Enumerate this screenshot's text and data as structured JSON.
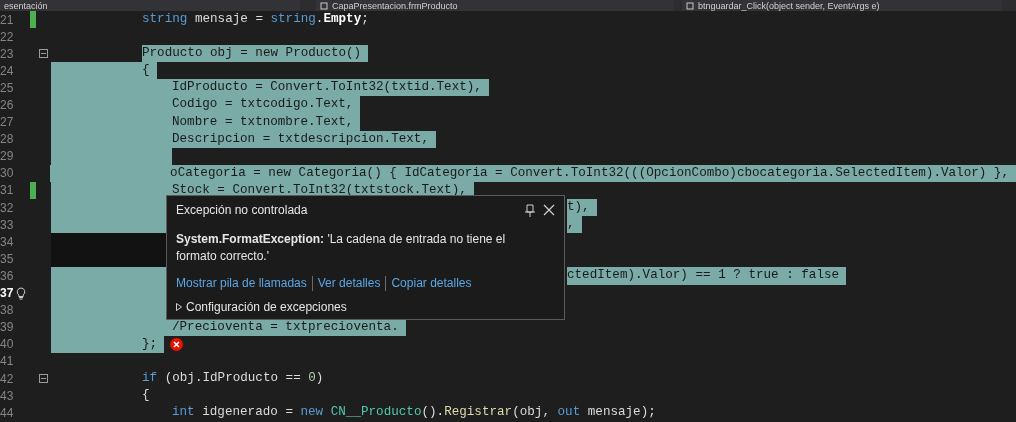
{
  "nav_bar": {
    "items": [
      {
        "label": "esentación",
        "icon": false
      },
      {
        "label": "CapaPresentacion.frmProducto",
        "icon": true
      },
      {
        "label": "btnguardar_Click(object sender, EventArgs e)",
        "icon": true
      }
    ]
  },
  "editor": {
    "lines": [
      {
        "number": "21",
        "kind": "code",
        "changed": true,
        "current": false,
        "fold": false,
        "selected": false,
        "tokens": [
          {
            "t": "string",
            "kind": "keyword",
            "selected": false
          },
          {
            "t": " mensaje = ",
            "kind": "plain",
            "selected": false
          },
          {
            "t": "string",
            "kind": "keyword",
            "selected": false
          },
          {
            "t": ".",
            "kind": "plain",
            "selected": false
          },
          {
            "t": "Empty",
            "kind": "bold",
            "selected": false
          },
          {
            "t": ";",
            "kind": "plain",
            "selected": false
          }
        ]
      },
      {
        "number": "22",
        "kind": "code",
        "changed": false,
        "current": false,
        "fold": false,
        "selected": false
      },
      {
        "number": "23",
        "kind": "code",
        "changed": false,
        "current": false,
        "fold": true,
        "selected": false,
        "tokens": [
          {
            "t": "Producto obj = new Producto()",
            "kind": "plain",
            "selected": true
          }
        ]
      },
      {
        "number": "24",
        "kind": "code",
        "changed": false,
        "current": false,
        "fold": false,
        "selected": true,
        "tokens": [
          {
            "t": "{",
            "kind": "plain",
            "selected": true
          }
        ],
        "children": [
          {
            "number": "25",
            "kind": "code",
            "changed": false,
            "current": false,
            "fold": false,
            "selected": true,
            "tokens": [
              {
                "t": "IdProducto = Convert.ToInt32(txtid.Text),",
                "kind": "plain",
                "selected": true
              }
            ]
          },
          {
            "number": "26",
            "kind": "code",
            "changed": false,
            "current": false,
            "fold": false,
            "selected": true,
            "tokens": [
              {
                "t": "Codigo = txtcodigo.Text,",
                "kind": "plain",
                "selected": true
              }
            ]
          },
          {
            "number": "27",
            "kind": "code",
            "changed": false,
            "current": false,
            "fold": false,
            "selected": true,
            "tokens": [
              {
                "t": "Nombre = txtnombre.Text,",
                "kind": "plain",
                "selected": true
              }
            ]
          },
          {
            "number": "28",
            "kind": "code",
            "changed": false,
            "current": false,
            "fold": false,
            "selected": true,
            "tokens": [
              {
                "t": "Descripcion = txtdescripcion.Text,",
                "kind": "plain",
                "selected": true
              }
            ]
          },
          {
            "number": "29",
            "kind": "code",
            "changed": false,
            "current": false,
            "fold": false,
            "selected": true
          },
          {
            "number": "30",
            "kind": "code",
            "changed": false,
            "current": false,
            "fold": false,
            "selected": true,
            "tokens": [
              {
                "t": "oCategoria = new Categoria() { IdCategoria = Convert.ToInt32(((OpcionCombo)cbocategoria.SelectedItem).Valor) },",
                "kind": "plain",
                "selected": true
              }
            ]
          },
          {
            "number": "31",
            "kind": "code",
            "changed": true,
            "current": false,
            "fold": false,
            "selected": true,
            "tokens": [
              {
                "t": "Stock = Convert.ToInt32(txtstock.Text),",
                "kind": "plain",
                "selected": true
              }
            ]
          },
          {
            "number": "32",
            "kind": "covered",
            "changed": false,
            "current": false,
            "fold": false,
            "selected": true,
            "tokens": [
              {
                "t": "t),",
                "kind": "plain",
                "selected": true
              }
            ]
          },
          {
            "number": "33",
            "kind": "covered",
            "changed": false,
            "current": false,
            "fold": false,
            "selected": true,
            "tokens": [
              {
                "t": ",",
                "kind": "plain",
                "selected": true
              }
            ]
          },
          {
            "number": "34",
            "kind": "covered",
            "changed": false,
            "current": false,
            "fold": false,
            "selected": false
          },
          {
            "number": "35",
            "kind": "covered",
            "changed": false,
            "current": false,
            "fold": false,
            "selected": false
          },
          {
            "number": "36",
            "kind": "covered",
            "changed": false,
            "current": false,
            "fold": false,
            "selected": true,
            "tokens": [
              {
                "t": "ctedItem).Valor) == 1 ? true : false",
                "kind": "plain",
                "selected": true
              }
            ]
          },
          {
            "number": "37",
            "kind": "covered",
            "changed": false,
            "current": true,
            "fold": false,
            "selected": true
          },
          {
            "number": "38",
            "kind": "covered",
            "changed": false,
            "current": false,
            "fold": false,
            "selected": true
          },
          {
            "number": "39",
            "kind": "code",
            "changed": false,
            "current": false,
            "fold": false,
            "selected": true,
            "tokens": [
              {
                "t": "/Precioventa = txtprecioventa.",
                "kind": "plain",
                "selected": true
              }
            ]
          }
        ]
      },
      {
        "number": "40",
        "kind": "code",
        "changed": false,
        "current": false,
        "fold": false,
        "selected": true,
        "error": true,
        "tokens": [
          {
            "t": "};",
            "kind": "plain",
            "selected": true
          }
        ]
      },
      {
        "number": "41",
        "kind": "code",
        "changed": false,
        "current": false,
        "fold": false,
        "selected": false
      },
      {
        "number": "42",
        "kind": "code",
        "changed": false,
        "current": false,
        "fold": true,
        "selected": false,
        "tokens": [
          {
            "t": "if",
            "kind": "keyword",
            "selected": false
          },
          {
            "t": " (obj.IdProducto == ",
            "kind": "plain",
            "selected": false
          },
          {
            "t": "0",
            "kind": "number",
            "selected": false
          },
          {
            "t": ")",
            "kind": "plain",
            "selected": false
          }
        ]
      },
      {
        "number": "43",
        "kind": "code",
        "changed": false,
        "current": false,
        "fold": false,
        "selected": false,
        "tokens": [
          {
            "t": "{",
            "kind": "plain",
            "selected": false
          }
        ],
        "children": [
          {
            "number": "44",
            "kind": "code",
            "changed": false,
            "current": false,
            "fold": false,
            "selected": false,
            "tokens": [
              {
                "t": "int",
                "kind": "keyword",
                "selected": false
              },
              {
                "t": " idgenerado = ",
                "kind": "plain",
                "selected": false
              },
              {
                "t": "new",
                "kind": "keyword",
                "selected": false
              },
              {
                "t": " CN__Producto",
                "kind": "type",
                "selected": false
              },
              {
                "t": "().",
                "kind": "plain",
                "selected": false
              },
              {
                "t": "Registrar",
                "kind": "method",
                "selected": false
              },
              {
                "t": "(obj, ",
                "kind": "plain",
                "selected": false
              },
              {
                "t": "out",
                "kind": "keyword",
                "selected": false
              },
              {
                "t": " mensaje);",
                "kind": "plain",
                "selected": false
              }
            ]
          }
        ]
      }
    ]
  },
  "exception_popup": {
    "title": "Excepción no controlada",
    "message": "**System.FormatException:** 'La cadena de entrada no tiene el formato correcto.'",
    "links": [
      "Mostrar pila de llamadas",
      "Ver detalles",
      "Copiar detalles"
    ],
    "settings": {
      "label": "Configuración de excepciones",
      "expanded": false
    }
  }
}
